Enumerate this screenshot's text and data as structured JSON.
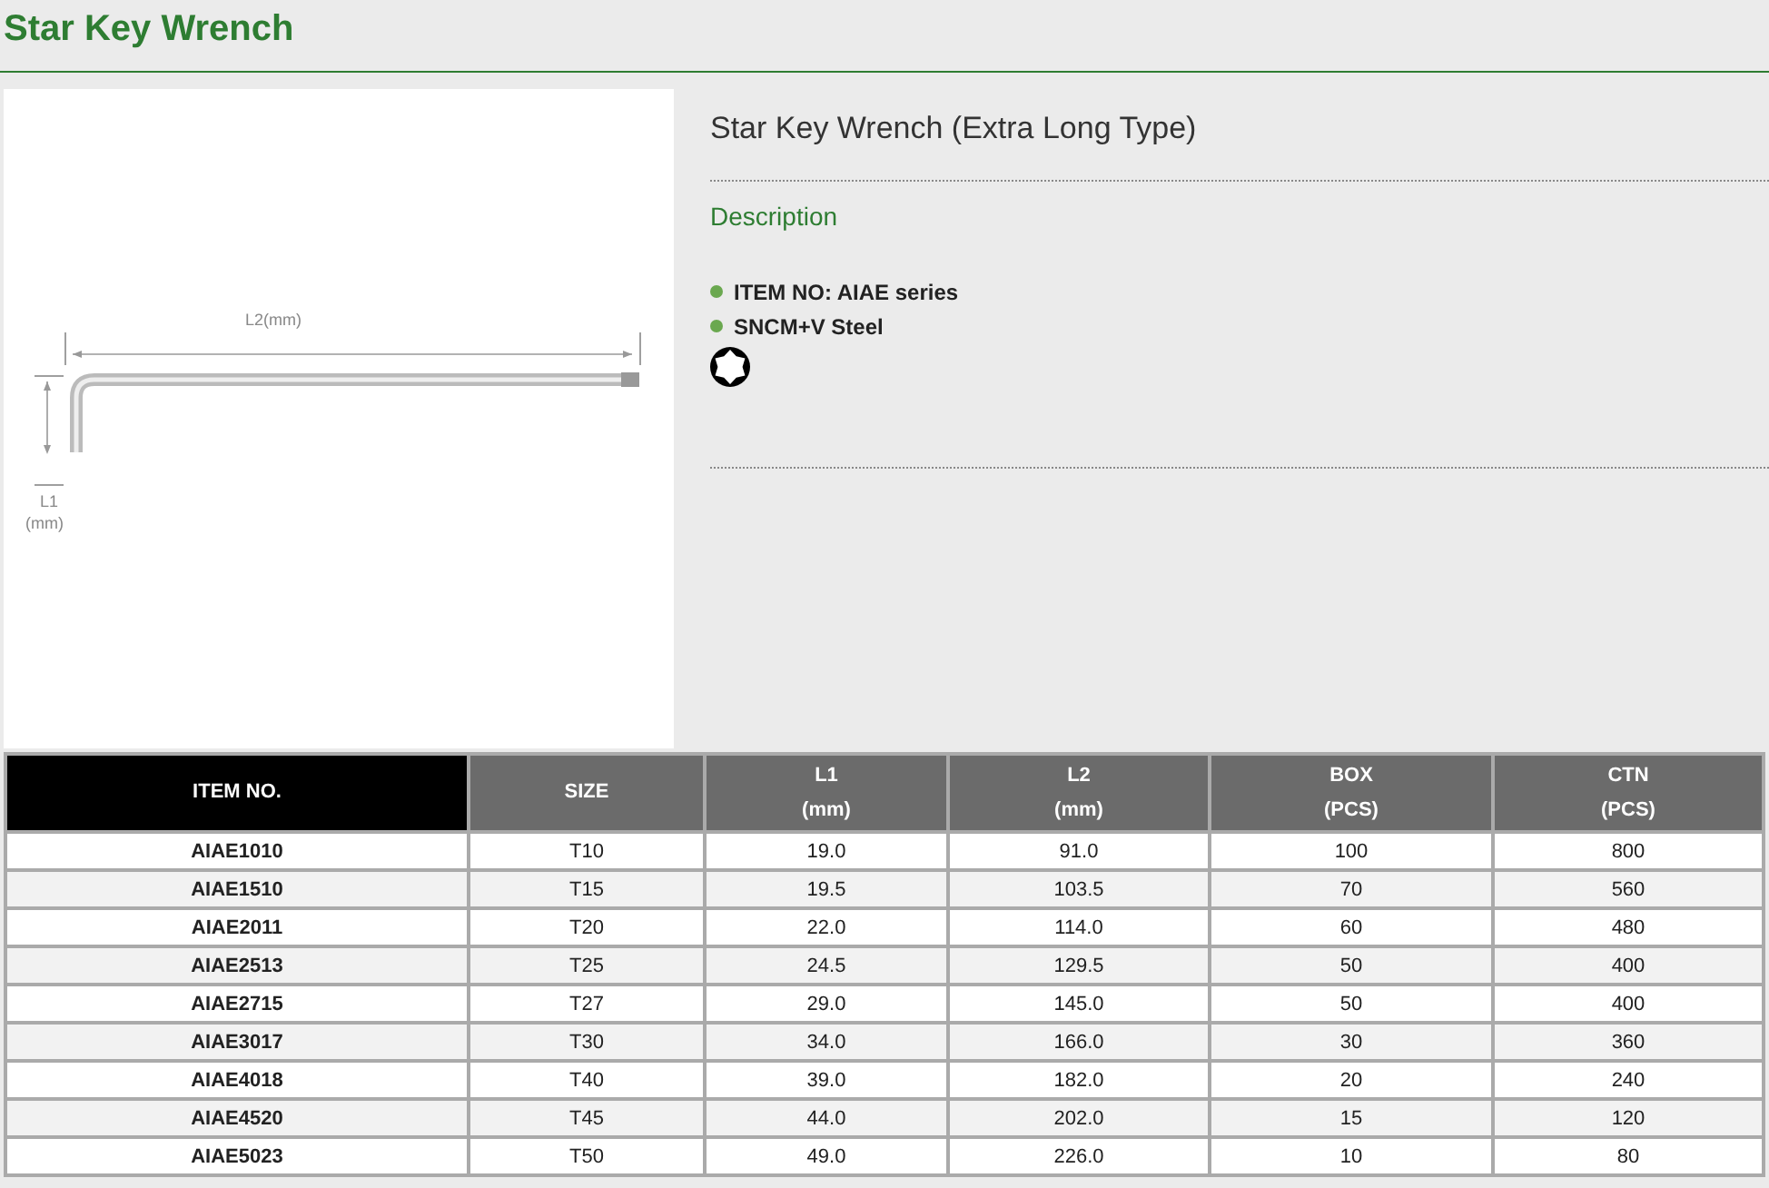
{
  "page_title": "Star Key Wrench",
  "diagram": {
    "l2_label": "L2(mm)",
    "l1_label": "L1",
    "l1_unit": "(mm)"
  },
  "product": {
    "name": "Star Key Wrench (Extra Long Type)",
    "section": "Description",
    "features": [
      "ITEM NO: AIAE series",
      "SNCM+V Steel"
    ]
  },
  "table": {
    "columns": [
      {
        "label": "ITEM NO.",
        "kind": "key"
      },
      {
        "label": "SIZE",
        "kind": "plain"
      },
      {
        "label": "L1",
        "unit": "(mm)",
        "kind": "plain"
      },
      {
        "label": "L2",
        "unit": "(mm)",
        "kind": "plain"
      },
      {
        "label": "BOX",
        "unit": "(PCS)",
        "kind": "plain"
      },
      {
        "label": "CTN",
        "unit": "(PCS)",
        "kind": "plain"
      }
    ],
    "rows": [
      [
        "AIAE1010",
        "T10",
        "19.0",
        "91.0",
        "100",
        "800"
      ],
      [
        "AIAE1510",
        "T15",
        "19.5",
        "103.5",
        "70",
        "560"
      ],
      [
        "AIAE2011",
        "T20",
        "22.0",
        "114.0",
        "60",
        "480"
      ],
      [
        "AIAE2513",
        "T25",
        "24.5",
        "129.5",
        "50",
        "400"
      ],
      [
        "AIAE2715",
        "T27",
        "29.0",
        "145.0",
        "50",
        "400"
      ],
      [
        "AIAE3017",
        "T30",
        "34.0",
        "166.0",
        "30",
        "360"
      ],
      [
        "AIAE4018",
        "T40",
        "39.0",
        "182.0",
        "20",
        "240"
      ],
      [
        "AIAE4520",
        "T45",
        "44.0",
        "202.0",
        "15",
        "120"
      ],
      [
        "AIAE5023",
        "T50",
        "49.0",
        "226.0",
        "10",
        "80"
      ]
    ]
  }
}
